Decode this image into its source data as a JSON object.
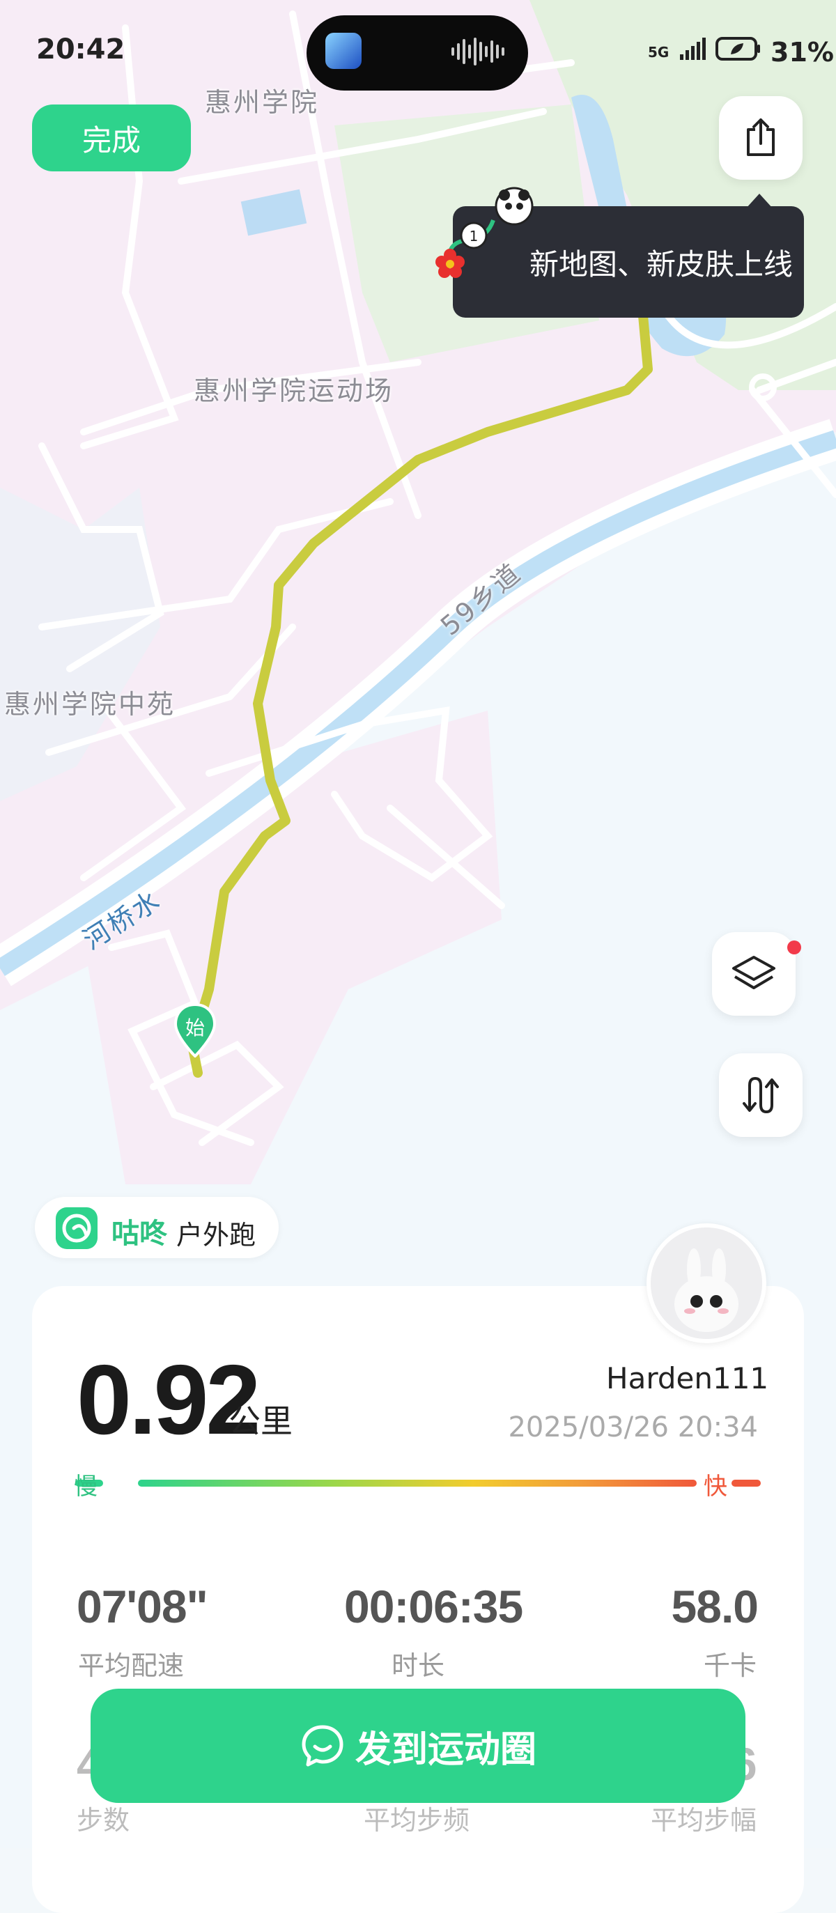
{
  "status_bar": {
    "time": "20:42",
    "network": "5G",
    "battery": "31%"
  },
  "map": {
    "labels": [
      "惠州学院",
      "惠州学院运动场",
      "59乡道",
      "惠州学院中苑",
      "河桥水"
    ],
    "start_marker": "始"
  },
  "header": {
    "done_label": "完成"
  },
  "tooltip": {
    "text": "新地图、新皮肤上线"
  },
  "brand": {
    "name": "咕咚",
    "sport_type": "户外跑"
  },
  "summary": {
    "distance": "0.92",
    "distance_unit": "公里",
    "username": "Harden111",
    "datetime": "2025/03/26 20:34",
    "pace_slow_label": "慢",
    "pace_fast_label": "快"
  },
  "stats": [
    {
      "value": "07'08\"",
      "label": "平均配速"
    },
    {
      "value": "00:06:35",
      "label": "时长"
    },
    {
      "value": "58.0",
      "label": "千卡"
    }
  ],
  "stats_row2_partial": {
    "value_left": "4",
    "value_right": "6",
    "labels": [
      "步数",
      "平均步频",
      "平均步幅"
    ]
  },
  "actions": {
    "send_label": "发到运动圈"
  },
  "colors": {
    "accent": "#2ed38c",
    "route": "#c9cc3f",
    "tooltip_bg": "#2c2e36"
  }
}
